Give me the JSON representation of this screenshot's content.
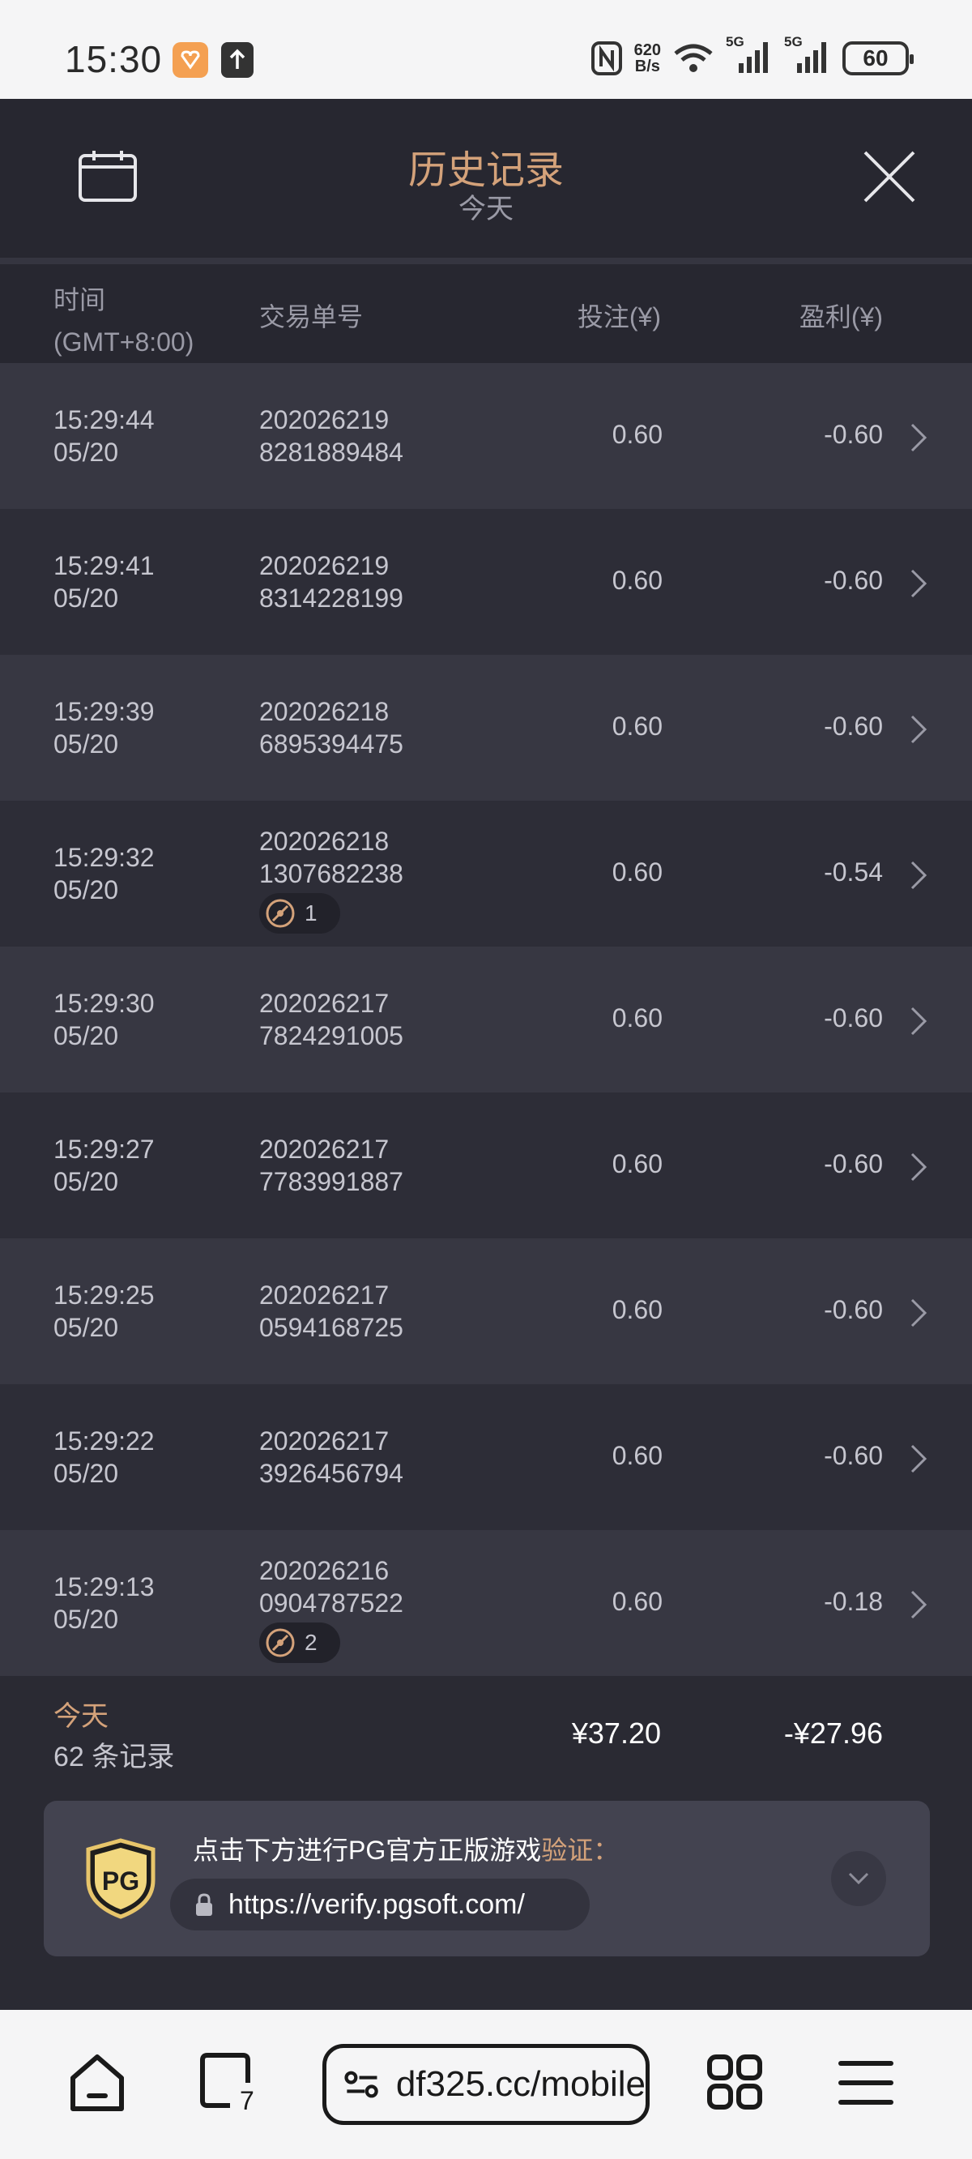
{
  "status_bar": {
    "time": "15:30",
    "net_speed_value": "620",
    "net_speed_unit": "B/s",
    "sig1_label": "5G",
    "sig2_label": "5G",
    "battery": "60"
  },
  "header": {
    "title": "历史记录",
    "subtitle": "今天"
  },
  "columns": {
    "time": "时间",
    "timezone": "(GMT+8:00)",
    "order": "交易单号",
    "bet": "投注(¥)",
    "profit": "盈利(¥)"
  },
  "rows": [
    {
      "time": "15:29:44",
      "date": "05/20",
      "order_a": "202026219",
      "order_b": "8281889484",
      "bet": "0.60",
      "profit": "-0.60",
      "tag": ""
    },
    {
      "time": "15:29:41",
      "date": "05/20",
      "order_a": "202026219",
      "order_b": "8314228199",
      "bet": "0.60",
      "profit": "-0.60",
      "tag": ""
    },
    {
      "time": "15:29:39",
      "date": "05/20",
      "order_a": "202026218",
      "order_b": "6895394475",
      "bet": "0.60",
      "profit": "-0.60",
      "tag": ""
    },
    {
      "time": "15:29:32",
      "date": "05/20",
      "order_a": "202026218",
      "order_b": "1307682238",
      "bet": "0.60",
      "profit": "-0.54",
      "tag": "1"
    },
    {
      "time": "15:29:30",
      "date": "05/20",
      "order_a": "202026217",
      "order_b": "7824291005",
      "bet": "0.60",
      "profit": "-0.60",
      "tag": ""
    },
    {
      "time": "15:29:27",
      "date": "05/20",
      "order_a": "202026217",
      "order_b": "7783991887",
      "bet": "0.60",
      "profit": "-0.60",
      "tag": ""
    },
    {
      "time": "15:29:25",
      "date": "05/20",
      "order_a": "202026217",
      "order_b": "0594168725",
      "bet": "0.60",
      "profit": "-0.60",
      "tag": ""
    },
    {
      "time": "15:29:22",
      "date": "05/20",
      "order_a": "202026217",
      "order_b": "3926456794",
      "bet": "0.60",
      "profit": "-0.60",
      "tag": ""
    },
    {
      "time": "15:29:13",
      "date": "05/20",
      "order_a": "202026216",
      "order_b": "0904787522",
      "bet": "0.60",
      "profit": "-0.18",
      "tag": "2"
    }
  ],
  "summary": {
    "label": "今天",
    "count": "62 条记录",
    "bet_total": "¥37.20",
    "profit_total": "-¥27.96"
  },
  "verify": {
    "text": "点击下方进行PG官方正版游戏",
    "accent": "验证：",
    "url": "https://verify.pgsoft.com/",
    "logo_text": "PG"
  },
  "browser": {
    "url": "df325.cc/mobile",
    "tab_count": "7"
  },
  "colors": {
    "accent": "#d4a27a",
    "bg": "#2a2a33",
    "row_light": "#373742",
    "row_dark": "#2d2d37"
  }
}
